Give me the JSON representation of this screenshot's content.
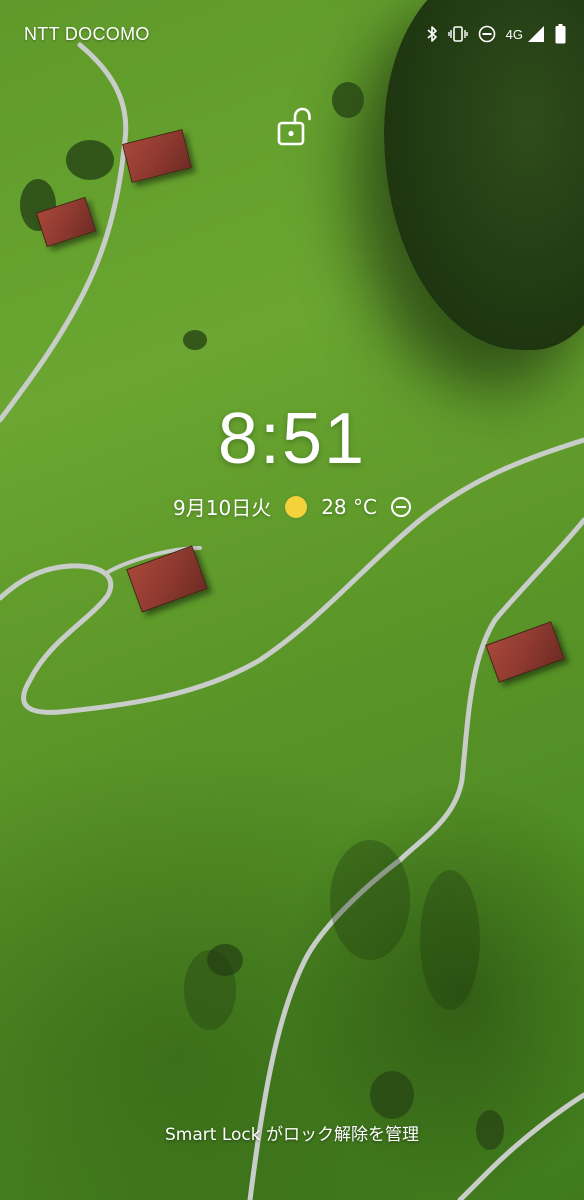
{
  "status_bar": {
    "carrier": "NTT DOCOMO",
    "network_type": "4G",
    "icons": [
      "bluetooth-icon",
      "vibrate-icon",
      "do-not-disturb-icon",
      "signal-icon",
      "battery-icon"
    ]
  },
  "lock_screen": {
    "lock_icon": "unlocked-padlock-icon",
    "time": "8:51",
    "date": "9月10日火",
    "weather_icon": "sun-icon",
    "temperature": "28 °C",
    "dnd_icon": "do-not-disturb-icon",
    "smart_lock_message": "Smart Lock がロック解除を管理"
  },
  "colors": {
    "grass": "#6aa631",
    "forest": "#213a12",
    "road": "#c9cdc9",
    "roof": "#9a3f33",
    "sun": "#f5d23b",
    "text": "#ffffff"
  }
}
